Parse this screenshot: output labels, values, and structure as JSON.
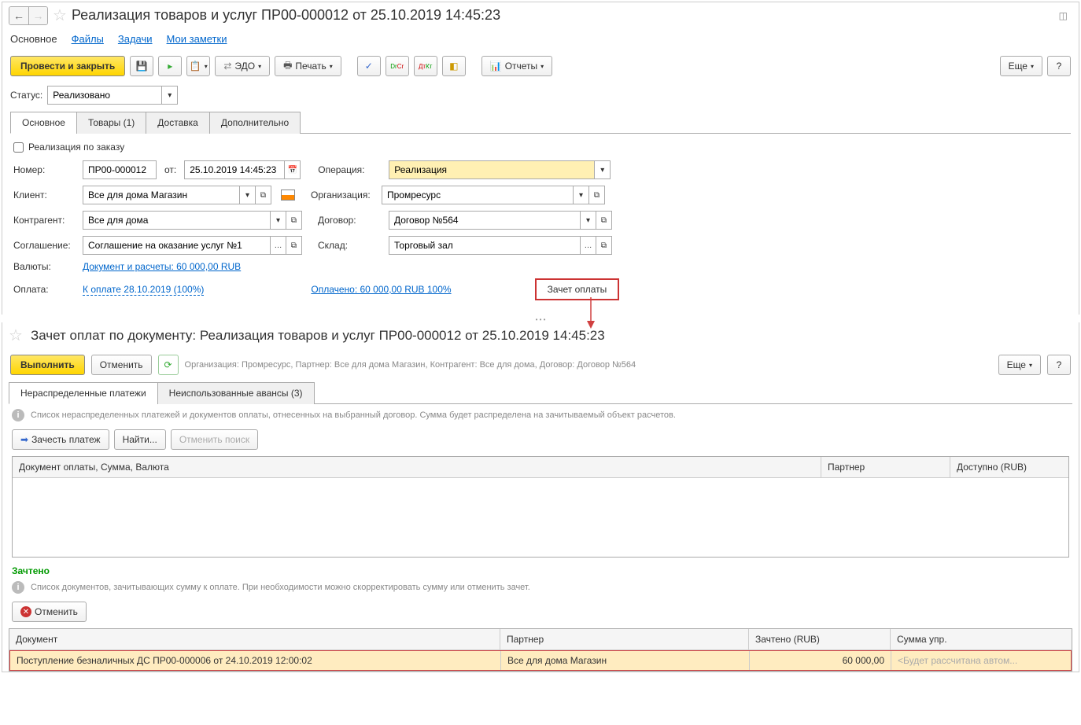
{
  "top": {
    "title": "Реализация товаров и услуг ПР00-000012 от 25.10.2019 14:45:23",
    "navTabs": {
      "main": "Основное",
      "files": "Файлы",
      "tasks": "Задачи",
      "notes": "Мои заметки"
    },
    "toolbar": {
      "postClose": "Провести и закрыть",
      "edo": "ЭДО",
      "print": "Печать",
      "reports": "Отчеты",
      "more": "Еще",
      "help": "?"
    },
    "statusLabel": "Статус:",
    "statusValue": "Реализовано",
    "tabs": {
      "main": "Основное",
      "goods": "Товары (1)",
      "delivery": "Доставка",
      "extra": "Дополнительно"
    },
    "chk": "Реализация по заказу",
    "labels": {
      "number": "Номер:",
      "from": "от:",
      "operation": "Операция:",
      "client": "Клиент:",
      "org": "Организация:",
      "contragent": "Контрагент:",
      "contract": "Договор:",
      "agreement": "Соглашение:",
      "warehouse": "Склад:",
      "currency": "Валюты:",
      "payment": "Оплата:"
    },
    "values": {
      "number": "ПР00-000012",
      "date": "25.10.2019 14:45:23",
      "operation": "Реализация",
      "client": "Все для дома Магазин",
      "org": "Промресурс",
      "contragent": "Все для дома",
      "contract": "Договор №564",
      "agreement": "Соглашение на оказание услуг №1",
      "warehouse": "Торговый зал"
    },
    "links": {
      "currency": "Документ и расчеты: 60 000,00 RUB",
      "payment": "К оплате 28.10.2019 (100%)",
      "paid": "Оплачено: 60 000,00 RUB  100%"
    },
    "offsetBtn": "Зачет оплаты"
  },
  "bottom": {
    "title": "Зачет оплат по документу: Реализация товаров и услуг ПР00-000012 от 25.10.2019 14:45:23",
    "toolbar": {
      "execute": "Выполнить",
      "cancel": "Отменить",
      "more": "Еще",
      "help": "?"
    },
    "context": "Организация: Промресурс, Партнер: Все для дома Магазин, Контрагент: Все для дома, Договор: Договор №564",
    "tabs": {
      "undist": "Нераспределенные платежи",
      "unused": "Неиспользованные авансы (3)"
    },
    "info1": "Список нераспределенных платежей и документов оплаты, отнесенных на выбранный договор. Сумма будет распределена на зачитываемый объект расчетов.",
    "btns": {
      "credit": "Зачесть платеж",
      "find": "Найти...",
      "cancelSearch": "Отменить поиск"
    },
    "table1": {
      "col1": "Документ оплаты, Сумма, Валюта",
      "col2": "Партнер",
      "col3": "Доступно (RUB)"
    },
    "creditedHdr": "Зачтено",
    "info2": "Список документов, зачитывающих сумму к оплате. При необходимости можно скорректировать сумму или отменить зачет.",
    "cancelBtn2": "Отменить",
    "table2": {
      "col1": "Документ",
      "col2": "Партнер",
      "col3": "Зачтено (RUB)",
      "col4": "Сумма упр."
    },
    "row": {
      "doc": "Поступление безналичных ДС ПР00-000006 от 24.10.2019 12:00:02",
      "partner": "Все для дома Магазин",
      "credited": "60 000,00",
      "sum": "<Будет рассчитана автом..."
    }
  }
}
